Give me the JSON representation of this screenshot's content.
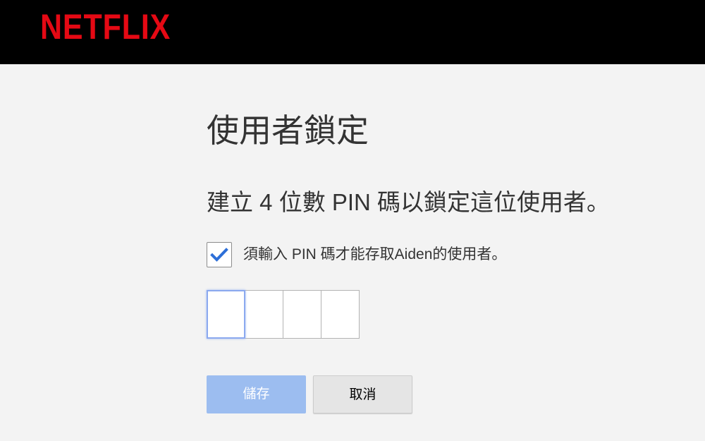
{
  "header": {
    "logo_text": "NETFLIX"
  },
  "colors": {
    "brand_red": "#e50914",
    "header_bg": "#000000",
    "page_bg": "#f3f3f3",
    "checkbox_check": "#2d6fd8",
    "save_button_disabled": "#9cbdf0",
    "pin_focus_border": "#8ba9ef"
  },
  "main": {
    "title": "使用者鎖定",
    "subtitle": "建立 4 位數 PIN 碼以鎖定這位使用者。",
    "require_pin": {
      "checked": true,
      "label": "須輸入 PIN 碼才能存取Aiden的使用者。",
      "icon": "checkmark-icon"
    },
    "pin": {
      "length": 4,
      "digits": [
        "",
        "",
        "",
        ""
      ],
      "focused_index": 0
    },
    "buttons": {
      "save_label": "儲存",
      "save_disabled": true,
      "cancel_label": "取消"
    }
  }
}
